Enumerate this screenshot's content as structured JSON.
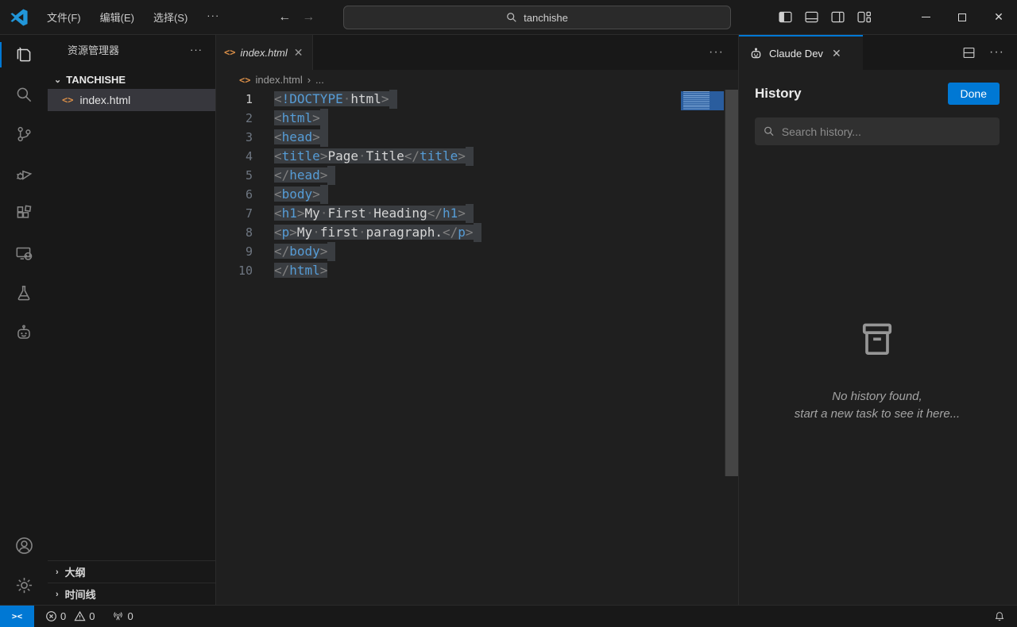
{
  "titlebar": {
    "menus": [
      "文件(F)",
      "编辑(E)",
      "选择(S)"
    ],
    "menu_overflow": "···",
    "nav_back": "←",
    "nav_forward": "→",
    "search_value": "tanchishe"
  },
  "sidebar": {
    "title": "资源管理器",
    "actions": "···",
    "workspace": {
      "chevron": "⌄",
      "name": "TANCHISHE"
    },
    "file": {
      "icon": "<>",
      "name": "index.html"
    },
    "outline": {
      "chevron": "›",
      "label": "大纲"
    },
    "timeline": {
      "chevron": "›",
      "label": "时间线"
    }
  },
  "editor": {
    "tab": {
      "icon": "<>",
      "label": "index.html",
      "close": "✕"
    },
    "tab_actions": "···",
    "breadcrumb": {
      "icon": "<>",
      "file": "index.html",
      "sep": "›",
      "more": "..."
    },
    "code": {
      "language": "html",
      "selection_color": "#3a3d41",
      "lines": [
        {
          "n": "1",
          "active": true,
          "nl": true,
          "tokens": [
            [
              "p",
              "<"
            ],
            [
              "b",
              "!DOCTYPE"
            ],
            [
              "w",
              "·"
            ],
            [
              "x",
              "html"
            ],
            [
              "p",
              ">"
            ]
          ]
        },
        {
          "n": "2",
          "nl": true,
          "tokens": [
            [
              "p",
              "<"
            ],
            [
              "b",
              "html"
            ],
            [
              "p",
              ">"
            ]
          ]
        },
        {
          "n": "3",
          "nl": true,
          "tokens": [
            [
              "p",
              "<"
            ],
            [
              "b",
              "head"
            ],
            [
              "p",
              ">"
            ]
          ]
        },
        {
          "n": "4",
          "nl": true,
          "tokens": [
            [
              "p",
              "<"
            ],
            [
              "b",
              "title"
            ],
            [
              "p",
              ">"
            ],
            [
              "x",
              "Page"
            ],
            [
              "w",
              "·"
            ],
            [
              "x",
              "Title"
            ],
            [
              "p",
              "</"
            ],
            [
              "b",
              "title"
            ],
            [
              "p",
              ">"
            ]
          ]
        },
        {
          "n": "5",
          "nl": true,
          "tokens": [
            [
              "p",
              "</"
            ],
            [
              "b",
              "head"
            ],
            [
              "p",
              ">"
            ]
          ]
        },
        {
          "n": "6",
          "nl": true,
          "tokens": [
            [
              "p",
              "<"
            ],
            [
              "b",
              "body"
            ],
            [
              "p",
              ">"
            ]
          ]
        },
        {
          "n": "7",
          "nl": true,
          "tokens": [
            [
              "p",
              "<"
            ],
            [
              "b",
              "h1"
            ],
            [
              "p",
              ">"
            ],
            [
              "x",
              "My"
            ],
            [
              "w",
              "·"
            ],
            [
              "x",
              "First"
            ],
            [
              "w",
              "·"
            ],
            [
              "x",
              "Heading"
            ],
            [
              "p",
              "</"
            ],
            [
              "b",
              "h1"
            ],
            [
              "p",
              ">"
            ]
          ]
        },
        {
          "n": "8",
          "nl": true,
          "tokens": [
            [
              "p",
              "<"
            ],
            [
              "b",
              "p"
            ],
            [
              "p",
              ">"
            ],
            [
              "x",
              "My"
            ],
            [
              "w",
              "·"
            ],
            [
              "x",
              "first"
            ],
            [
              "w",
              "·"
            ],
            [
              "x",
              "paragraph."
            ],
            [
              "p",
              "</"
            ],
            [
              "b",
              "p"
            ],
            [
              "p",
              ">"
            ]
          ]
        },
        {
          "n": "9",
          "nl": true,
          "tokens": [
            [
              "p",
              "</"
            ],
            [
              "b",
              "body"
            ],
            [
              "p",
              ">"
            ]
          ]
        },
        {
          "n": "10",
          "nl": false,
          "tokens": [
            [
              "p",
              "</"
            ],
            [
              "b",
              "html"
            ],
            [
              "p",
              ">"
            ]
          ]
        }
      ]
    }
  },
  "panel": {
    "tab": {
      "label": "Claude Dev",
      "close": "✕"
    },
    "actions_more": "···",
    "history": {
      "heading": "History",
      "done_label": "Done",
      "search_placeholder": "Search history...",
      "empty_line1": "No history found,",
      "empty_line2": "start a new task to see it here..."
    }
  },
  "statusbar": {
    "remote_glyph": "><",
    "errors": "0",
    "warnings": "0",
    "ports": "0"
  },
  "colors": {
    "accent_blue": "#0078d4",
    "tag_blue": "#569cd6",
    "punct_gray": "#808080",
    "code_text": "#d6d6d6",
    "selection": "#3a3d41",
    "file_icon_orange": "#d98e48",
    "editor_bg": "#1f1f1f",
    "chrome_bg": "#181818"
  }
}
